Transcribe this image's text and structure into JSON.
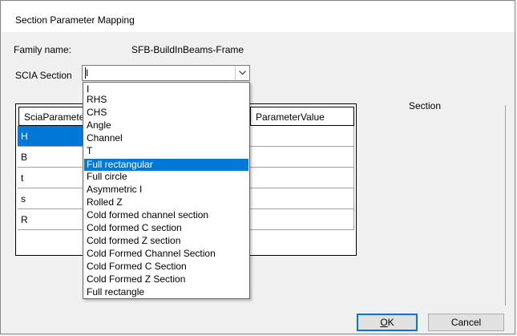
{
  "window": {
    "title": "Section Parameter Mapping"
  },
  "family": {
    "label": "Family name:",
    "value": "SFB-BuildInBeams-Frame"
  },
  "scia": {
    "label": "SCIA Section",
    "selected_value": "I"
  },
  "grid": {
    "columns": [
      "SciaParameter",
      "ParameterValue"
    ],
    "rows": [
      "H",
      "B",
      "t",
      "s",
      "R"
    ],
    "selected_row": 0
  },
  "section_label": "Section",
  "dropdown": {
    "options": [
      "I",
      "RHS",
      "CHS",
      "Angle",
      "Channel",
      "T",
      "Full rectangular",
      "Full circle",
      "Asymmetric I",
      "Rolled Z",
      "Cold formed channel section",
      "Cold formed C section",
      "Cold formed Z section",
      "Cold Formed Channel Section",
      "Cold Formed C Section",
      "Cold Formed Z Section",
      "Full rectangle"
    ],
    "highlighted": 6
  },
  "buttons": {
    "ok_letter": "O",
    "ok_rest": "K",
    "cancel": "Cancel"
  },
  "colors": {
    "selection": "#0078d7",
    "default_border": "#0078d7"
  }
}
